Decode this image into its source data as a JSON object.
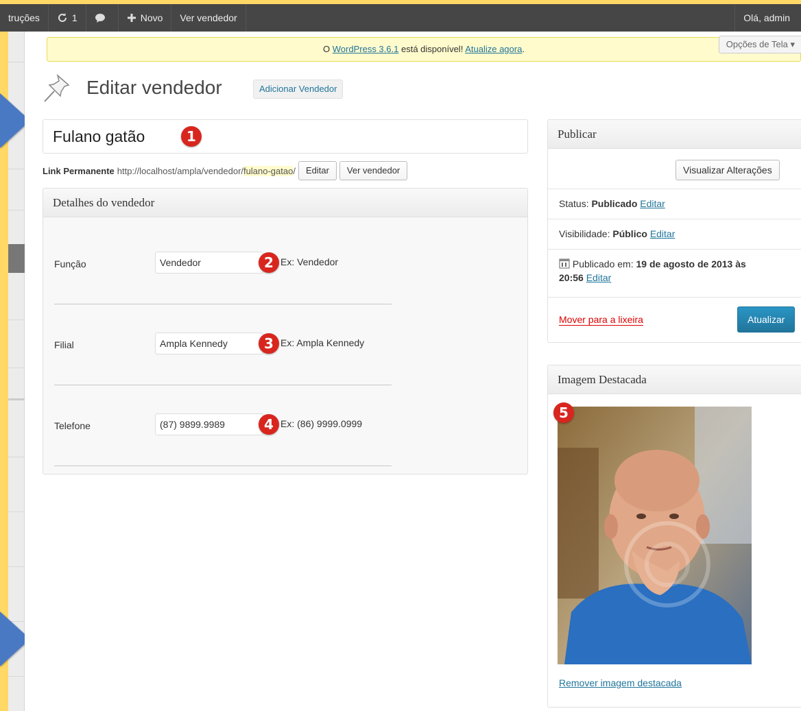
{
  "admin_bar": {
    "items": [
      {
        "label": "truções"
      },
      {
        "label": "1"
      },
      {
        "label": ""
      },
      {
        "label": "Novo"
      },
      {
        "label": "Ver vendedor"
      }
    ],
    "greeting": "Olá, admin"
  },
  "notice": {
    "prefix": "O ",
    "link_wordpress": "WordPress 3.6.1",
    "middle": " está disponível! ",
    "link_update": "Atualize agora",
    "suffix": "."
  },
  "screen_options": "Opções de Tela",
  "page": {
    "title": "Editar vendedor",
    "add_new_label": "Adicionar Vendedor"
  },
  "post_title": "Fulano gatão",
  "permalink": {
    "label": "Link Permanente",
    "base_url": "http://localhost/ampla/vendedor/",
    "slug": "fulano-gatao",
    "trailing": "/",
    "edit_label": "Editar",
    "view_label": "Ver vendedor"
  },
  "details_box": {
    "title": "Detalhes do vendedor",
    "fields": [
      {
        "label": "Função",
        "value": "Vendedor",
        "hint": "Ex: Vendedor",
        "badge": "2"
      },
      {
        "label": "Filial",
        "value": "Ampla Kennedy",
        "hint": "Ex: Ampla Kennedy",
        "badge": "3"
      },
      {
        "label": "Telefone",
        "value": "(87) 9899.9989",
        "hint": "Ex: (86) 9999.0999",
        "badge": "4"
      }
    ]
  },
  "title_badge": "1",
  "publish_box": {
    "title": "Publicar",
    "preview_label": "Visualizar Alterações",
    "status_label": "Status: ",
    "status_value": "Publicado",
    "visibility_label": "Visibilidade: ",
    "visibility_value": "Público",
    "published_label": "Publicado em: ",
    "published_date": "19 de agosto de 2013 às",
    "published_time": "20:56",
    "edit_label": "Editar",
    "trash_label": "Mover para a lixeira",
    "update_label": "Atualizar"
  },
  "featured_box": {
    "title": "Imagem Destacada",
    "badge": "5",
    "remove_label": "Remover imagem destacada"
  },
  "colors": {
    "frame": "#ffd866",
    "admin_bar": "#464646",
    "link": "#21759b",
    "badge": "#d8261f",
    "arrow": "#4a79c4",
    "update_button": "#21759b",
    "trash": "#dd0000"
  }
}
